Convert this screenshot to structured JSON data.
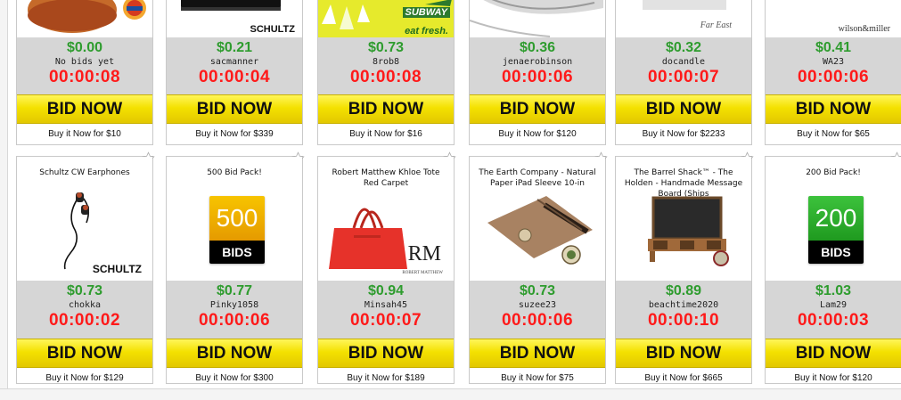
{
  "colors": {
    "price": "#2e9c2e",
    "timer": "#ff1a1a",
    "bid_button": "#f4e100",
    "info_bg": "#d6d6d6"
  },
  "row1": [
    {
      "price": "$0.00",
      "bidder": "No bids yet",
      "timer": "00:00:08",
      "bid_label": "BID NOW",
      "buy_now": "Buy it Now for $10",
      "image_icon": "burger-image"
    },
    {
      "price": "$0.21",
      "bidder": "sacmanner",
      "timer": "00:00:04",
      "bid_label": "BID NOW",
      "buy_now": "Buy it Now for $339",
      "image_icon": "schultz-product-image",
      "brand": "SCHULTZ"
    },
    {
      "price": "$0.73",
      "bidder": "8rob8",
      "timer": "00:00:08",
      "bid_label": "BID NOW",
      "buy_now": "Buy it Now for $16",
      "image_icon": "subway-card-image",
      "brand": "SUBWAY",
      "tagline": "eat fresh."
    },
    {
      "price": "$0.36",
      "bidder": "jenaerobinson",
      "timer": "00:00:06",
      "bid_label": "BID NOW",
      "buy_now": "Buy it Now for $120",
      "image_icon": "pillow-image"
    },
    {
      "price": "$0.32",
      "bidder": "docandle",
      "timer": "00:00:07",
      "bid_label": "BID NOW",
      "buy_now": "Buy it Now for $2233",
      "image_icon": "far-east-image",
      "brand": "Far East"
    },
    {
      "price": "$0.41",
      "bidder": "WA23",
      "timer": "00:00:06",
      "bid_label": "BID NOW",
      "buy_now": "Buy it Now for $65",
      "image_icon": "wilson-miller-image",
      "brand": "wilson&miller"
    }
  ],
  "row2": [
    {
      "title": "Schultz CW Earphones",
      "price": "$0.73",
      "bidder": "chokka",
      "timer": "00:00:02",
      "bid_label": "BID NOW",
      "buy_now": "Buy it Now for $129",
      "image_icon": "earphones-image",
      "brand": "SCHULTZ"
    },
    {
      "title": "500 Bid Pack!",
      "price": "$0.77",
      "bidder": "Pinky1058",
      "timer": "00:00:06",
      "bid_label": "BID NOW",
      "buy_now": "Buy it Now for $300",
      "image_icon": "bid-pack-500-image",
      "pack_count": "500",
      "pack_label": "BIDS",
      "pack_color": "#f1b000"
    },
    {
      "title": "Robert Matthew Khloe Tote Red Carpet",
      "price": "$0.94",
      "bidder": "Minsah45",
      "timer": "00:00:07",
      "bid_label": "BID NOW",
      "buy_now": "Buy it Now for $189",
      "image_icon": "red-tote-bag-image",
      "brand": "RM",
      "brand_sub": "ROBERT MATTHEW"
    },
    {
      "title": "The Earth Company - Natural Paper iPad Sleeve 10-in",
      "price": "$0.73",
      "bidder": "suzee23",
      "timer": "00:00:06",
      "bid_label": "BID NOW",
      "buy_now": "Buy it Now for $75",
      "image_icon": "ipad-sleeve-image"
    },
    {
      "title": "The Barrel Shack™ - The Holden - Handmade Message Board (Ships",
      "price": "$0.89",
      "bidder": "beachtime2020",
      "timer": "00:00:10",
      "bid_label": "BID NOW",
      "buy_now": "Buy it Now for $665",
      "image_icon": "message-board-image"
    },
    {
      "title": "200 Bid Pack!",
      "price": "$1.03",
      "bidder": "Lam29",
      "timer": "00:00:03",
      "bid_label": "BID NOW",
      "buy_now": "Buy it Now for $120",
      "image_icon": "bid-pack-200-image",
      "pack_count": "200",
      "pack_label": "BIDS",
      "pack_color": "#2dac2d"
    }
  ]
}
